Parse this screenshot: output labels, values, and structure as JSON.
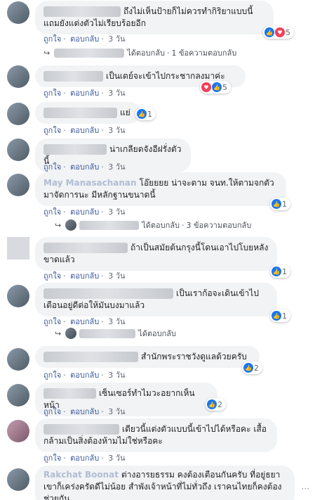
{
  "actions": {
    "like": "ถูกใจ",
    "reply": "ตอบกลับ",
    "sep": "·"
  },
  "comments": [
    {
      "text": "ถึงไม่เห็นป้ายก็ไม่ควรทำกิริยาแบบนี้ แถมยังแต่งตัวไม่เรียบร้อยอีก",
      "time": "3 วัน",
      "reactions": "5",
      "reply_action": "ได้ตอบกลับ",
      "reply_count": "1 ข้อความตอบกลับ"
    },
    {
      "text": "เป็นเดย์จะเข้าไปกระชากลงมาค่ะ",
      "time": "3 วัน",
      "reactions": "5"
    },
    {
      "text": "แย่",
      "time": "3 วัน",
      "reactions": "1"
    },
    {
      "text": "น่าเกลียดจังอีฝรั่งตัวนี้",
      "time": "3 วัน"
    },
    {
      "name": "May Manasachanan",
      "text": "โอ๊ยยยย น่าจะตาม จนท.ให้ตามจกตัวมาจัดการนะ มีหลักฐานขนาดนี้",
      "time": "3 วัน",
      "reactions": "1",
      "reply_action": "ได้ตอบกลับ",
      "reply_count": "3 ข้อความตอบกลับ"
    },
    {
      "text": "ถ้าเป็นสมัยต้นกรุงนี้โดนเอาไปโบยหลังขาดแล้ว",
      "time": "3 วัน",
      "reactions": "1"
    },
    {
      "text": "เป็นเราก้อจะเดินเข้าไปเตือนอยู่ดีต่อให้มันบงมาแล้ว",
      "time": "3 วัน",
      "reactions": "1",
      "reply_action": "ได้ตอบกลับ"
    },
    {
      "text": "สำนักพระราชวังดูแลด้วยครับ",
      "time": "3 วัน",
      "reactions": "2"
    },
    {
      "text": "เซ็นเซอร์ทำไมวะอยากเห็นหน้า",
      "time": "3 วัน",
      "reactions": "2"
    },
    {
      "text": "เดียวนี้แต่งตัวแบบนี้เข้าไปได้หรือคะ เสื้อกล้ามเป็นสิ่งต้องห้ามไม่ใช่หรือคะ",
      "time": "3 วัน"
    },
    {
      "name": "Rakchat Boonat",
      "text": "ต่างอารยธรรม คงต้องเตือนกันครับ ที่อยู่ธยาเขาก็เคร่งครัดดีไม่น้อย สำพังเจ้าหน้าที่ไม่ทั่วถึง เราคนไทยก็คงต้องช่วยกัน"
    }
  ],
  "colors": {
    "link": "#385898",
    "like": "#1877f2",
    "love": "#f33e58",
    "bubble": "#f2f3f5"
  }
}
